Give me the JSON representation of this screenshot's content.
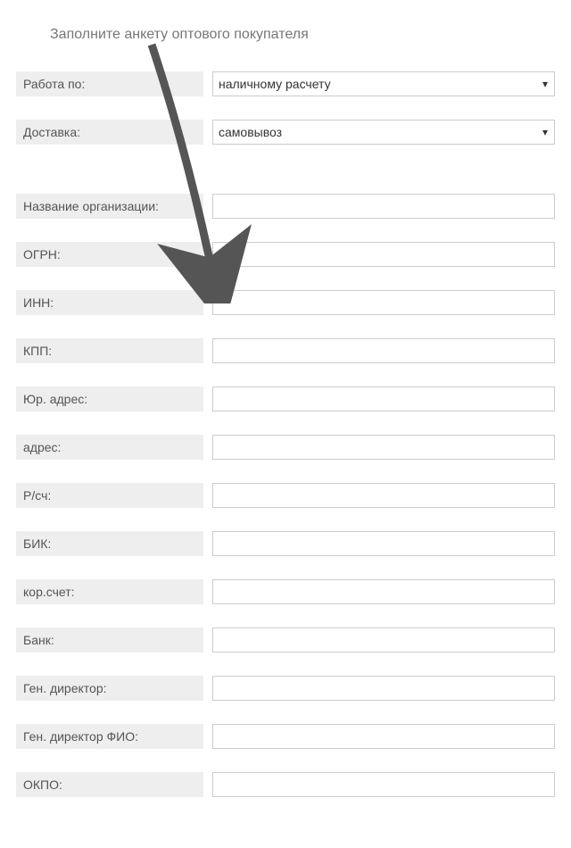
{
  "title": "Заполните анкету оптового покупателя",
  "selects": {
    "work_by": {
      "label": "Работа по:",
      "value": "наличному расчету"
    },
    "delivery": {
      "label": "Доставка:",
      "value": "самовывоз"
    }
  },
  "fields": {
    "org_name": {
      "label": "Название организации:",
      "value": ""
    },
    "ogrn": {
      "label": "ОГРН:",
      "value": ""
    },
    "inn": {
      "label": "ИНН:",
      "value": ""
    },
    "kpp": {
      "label": "КПП:",
      "value": ""
    },
    "jur_address": {
      "label": "Юр. адрес:",
      "value": ""
    },
    "address": {
      "label": "адрес:",
      "value": ""
    },
    "rsch": {
      "label": "Р/сч:",
      "value": ""
    },
    "bik": {
      "label": "БИК:",
      "value": ""
    },
    "kor_account": {
      "label": "кор.счет:",
      "value": ""
    },
    "bank": {
      "label": "Банк:",
      "value": ""
    },
    "gen_director": {
      "label": "Ген. директор:",
      "value": ""
    },
    "gen_director_fio": {
      "label": "Ген. директор ФИО:",
      "value": ""
    },
    "okpo": {
      "label": "ОКПО:",
      "value": ""
    }
  }
}
